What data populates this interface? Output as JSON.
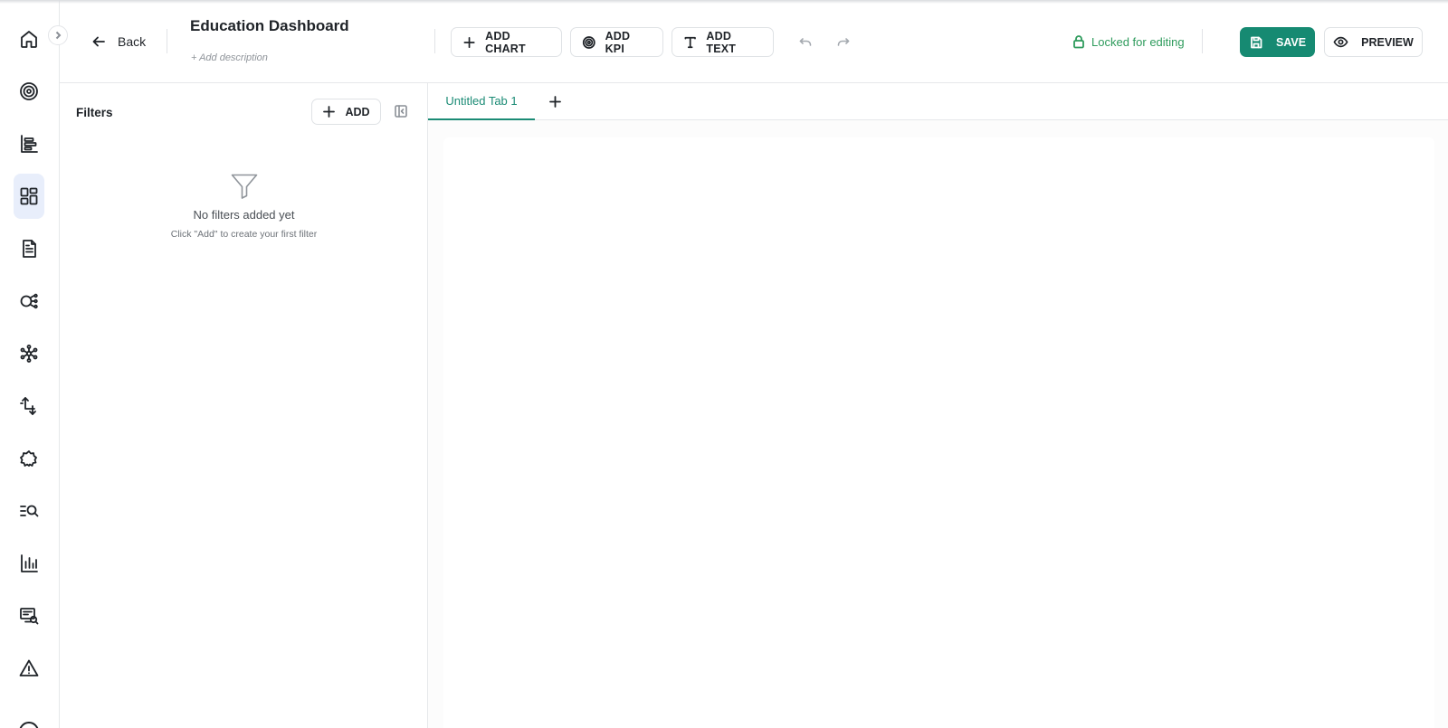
{
  "header": {
    "back_label": "Back",
    "title": "Education Dashboard",
    "description_placeholder": "+ Add description",
    "add_chart_label": "ADD CHART",
    "add_kpi_label": "ADD KPI",
    "add_text_label": "ADD TEXT",
    "lock_status": "Locked for editing",
    "save_label": "SAVE",
    "preview_label": "PREVIEW"
  },
  "filters": {
    "title": "Filters",
    "add_label": "ADD",
    "empty_title": "No filters added yet",
    "empty_subtitle": "Click \"Add\" to create your first filter"
  },
  "tabs": [
    {
      "label": "Untitled Tab 1",
      "active": true
    }
  ],
  "sidebar": {
    "icons": [
      "home-icon",
      "target-icon",
      "list-chart-icon",
      "dashboard-icon",
      "document-icon",
      "flow-icon",
      "network-icon",
      "transform-icon",
      "bug-icon",
      "search-list-icon",
      "bar-chart-icon",
      "monitor-search-icon",
      "warning-icon"
    ],
    "active_index": 3
  },
  "colors": {
    "accent": "#168a72",
    "tab_active": "#1b8b75",
    "lock_green": "#2e9b5c",
    "rail_active_bg": "#e8eefb"
  }
}
